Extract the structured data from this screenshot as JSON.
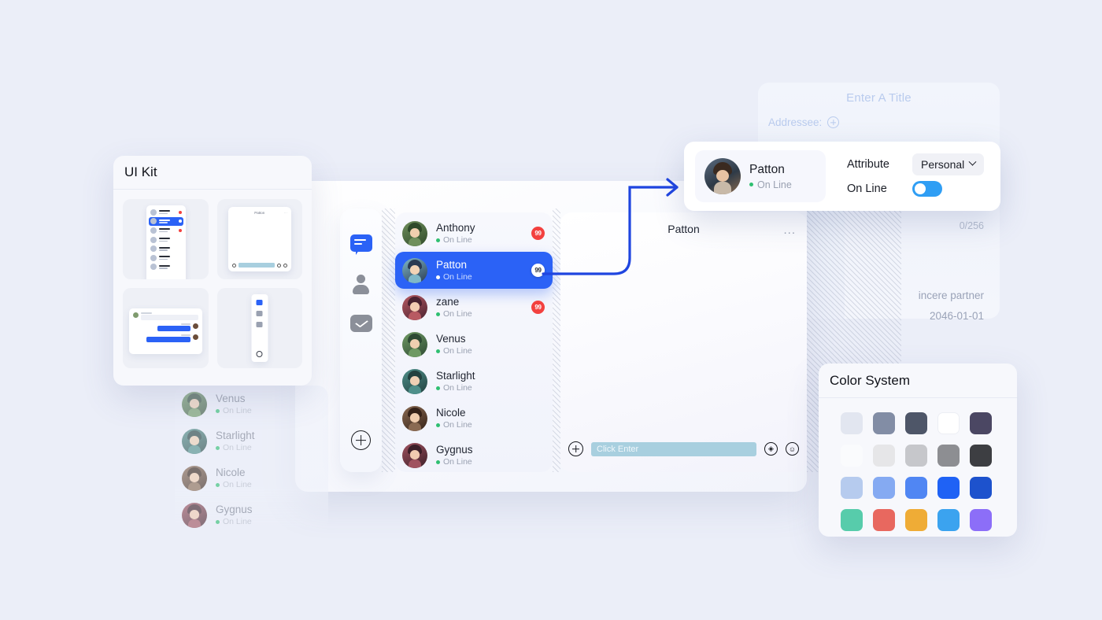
{
  "background": {
    "canvas_color": "#ebeef8"
  },
  "compose_panel": {
    "title": "Enter A Title",
    "addressee_label": "Addressee:",
    "char_count": "0/256",
    "signature": "incere partner",
    "date": "2046-01-01"
  },
  "app_window": {
    "rail": [
      {
        "name": "chat",
        "icon": "chat-bubble-icon",
        "active": true
      },
      {
        "name": "contacts",
        "icon": "person-icon",
        "active": false
      },
      {
        "name": "mail",
        "icon": "envelope-icon",
        "active": false
      }
    ],
    "rail_add_label": "add-icon",
    "contacts": [
      {
        "name": "Anthony",
        "status": "On Line",
        "badge": "99",
        "selected": false
      },
      {
        "name": "Patton",
        "status": "On Line",
        "badge": "99",
        "selected": true
      },
      {
        "name": "zane",
        "status": "On Line",
        "badge": "99",
        "selected": false
      },
      {
        "name": "Venus",
        "status": "On Line",
        "badge": "",
        "selected": false
      },
      {
        "name": "Starlight",
        "status": "On Line",
        "badge": "",
        "selected": false
      },
      {
        "name": "Nicole",
        "status": "On Line",
        "badge": "",
        "selected": false
      },
      {
        "name": "Gygnus",
        "status": "On Line",
        "badge": "",
        "selected": false
      }
    ],
    "chat": {
      "title": "Patton",
      "more_label": "...",
      "input_placeholder": "Click Enter",
      "add_icon": "plus-circle-icon",
      "voice_icon": "voice-icon",
      "emoji_icon": "emoji-icon"
    }
  },
  "ghost_list": [
    {
      "name": "Venus",
      "status": "On Line"
    },
    {
      "name": "Starlight",
      "status": "On Line"
    },
    {
      "name": "Nicole",
      "status": "On Line"
    },
    {
      "name": "Gygnus",
      "status": "On Line"
    }
  ],
  "ui_kit": {
    "title": "UI Kit",
    "tiles": [
      {
        "name": "contact-list-thumbnail"
      },
      {
        "name": "chat-window-thumbnail"
      },
      {
        "name": "message-bubbles-thumbnail"
      },
      {
        "name": "icon-rail-thumbnail"
      }
    ]
  },
  "detail_card": {
    "user_name": "Patton",
    "user_status": "On Line",
    "attribute_label": "Attribute",
    "attribute_value": "Personal",
    "online_label": "On Line",
    "online_enabled": true
  },
  "color_system": {
    "title": "Color System",
    "swatches": [
      "#e2e6f0",
      "#828da5",
      "#4e5668",
      "#ffffff",
      "#4b4763",
      "#fafbfd",
      "#e6e6e8",
      "#c6c7cb",
      "#8d8e92",
      "#3d3e42",
      "#b6cbee",
      "#85aaf2",
      "#5086f3",
      "#1f62f5",
      "#1d52cd",
      "#57ccab",
      "#e8685f",
      "#efac36",
      "#3ba3ef",
      "#8c6ef8"
    ]
  },
  "connector": {
    "color": "#1f45e0",
    "label": "selected-contact-to-detail-arrow"
  }
}
